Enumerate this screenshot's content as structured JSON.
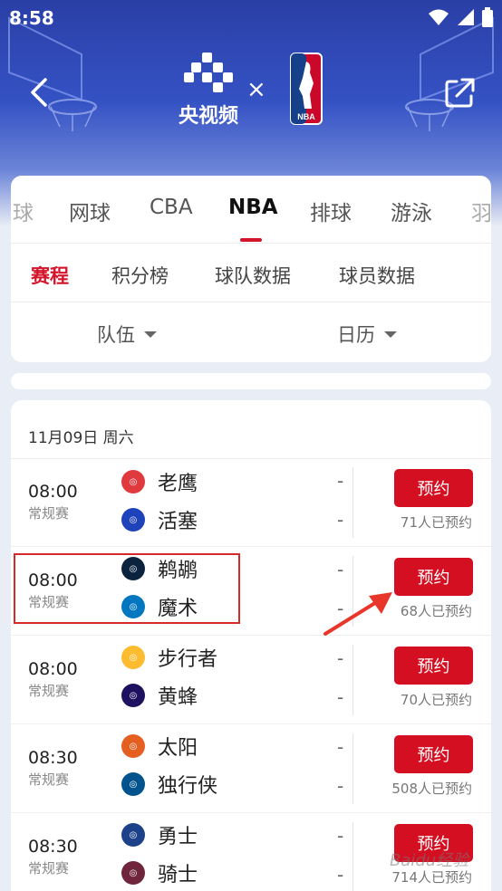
{
  "status_bar": {
    "time": "8:58"
  },
  "header": {
    "brand_label": "央视频",
    "times_sign": "×",
    "nba_logo_text": "NBA"
  },
  "sport_tabs": [
    {
      "label": "球"
    },
    {
      "label": "网球"
    },
    {
      "label": "CBA"
    },
    {
      "label": "NBA"
    },
    {
      "label": "排球"
    },
    {
      "label": "游泳"
    },
    {
      "label": "羽"
    }
  ],
  "sub_tabs": [
    "赛程",
    "积分榜",
    "球队数据",
    "球员数据"
  ],
  "filters": {
    "team": "队伍",
    "calendar": "日历"
  },
  "date_label": "11月09日 周六",
  "reserve_label": "预约",
  "matches": [
    {
      "time": "08:00",
      "type": "常规赛",
      "home": {
        "name": "老鹰",
        "logo_color": "#e03a3e"
      },
      "away": {
        "name": "活塞",
        "logo_color": "#1d42ba"
      },
      "home_score": "-",
      "away_score": "-",
      "reserve_count": "71人已预约"
    },
    {
      "time": "08:00",
      "type": "常规赛",
      "home": {
        "name": "鹈鹕",
        "logo_color": "#0c2340"
      },
      "away": {
        "name": "魔术",
        "logo_color": "#0077c0"
      },
      "home_score": "-",
      "away_score": "-",
      "reserve_count": "68人已预约"
    },
    {
      "time": "08:00",
      "type": "常规赛",
      "home": {
        "name": "步行者",
        "logo_color": "#fdbb30"
      },
      "away": {
        "name": "黄蜂",
        "logo_color": "#1d1160"
      },
      "home_score": "-",
      "away_score": "-",
      "reserve_count": "70人已预约"
    },
    {
      "time": "08:30",
      "type": "常规赛",
      "home": {
        "name": "太阳",
        "logo_color": "#e56020"
      },
      "away": {
        "name": "独行侠",
        "logo_color": "#00538c"
      },
      "home_score": "-",
      "away_score": "-",
      "reserve_count": "508人已预约"
    },
    {
      "time": "08:30",
      "type": "常规赛",
      "home": {
        "name": "勇士",
        "logo_color": "#1d428a"
      },
      "away": {
        "name": "骑士",
        "logo_color": "#6f263d"
      },
      "home_score": "-",
      "away_score": "-",
      "reserve_count": "714人已预约"
    }
  ],
  "watermark": "Baidu经验",
  "colors": {
    "accent": "#d40f22",
    "header_blue": "#2a3fa6"
  }
}
